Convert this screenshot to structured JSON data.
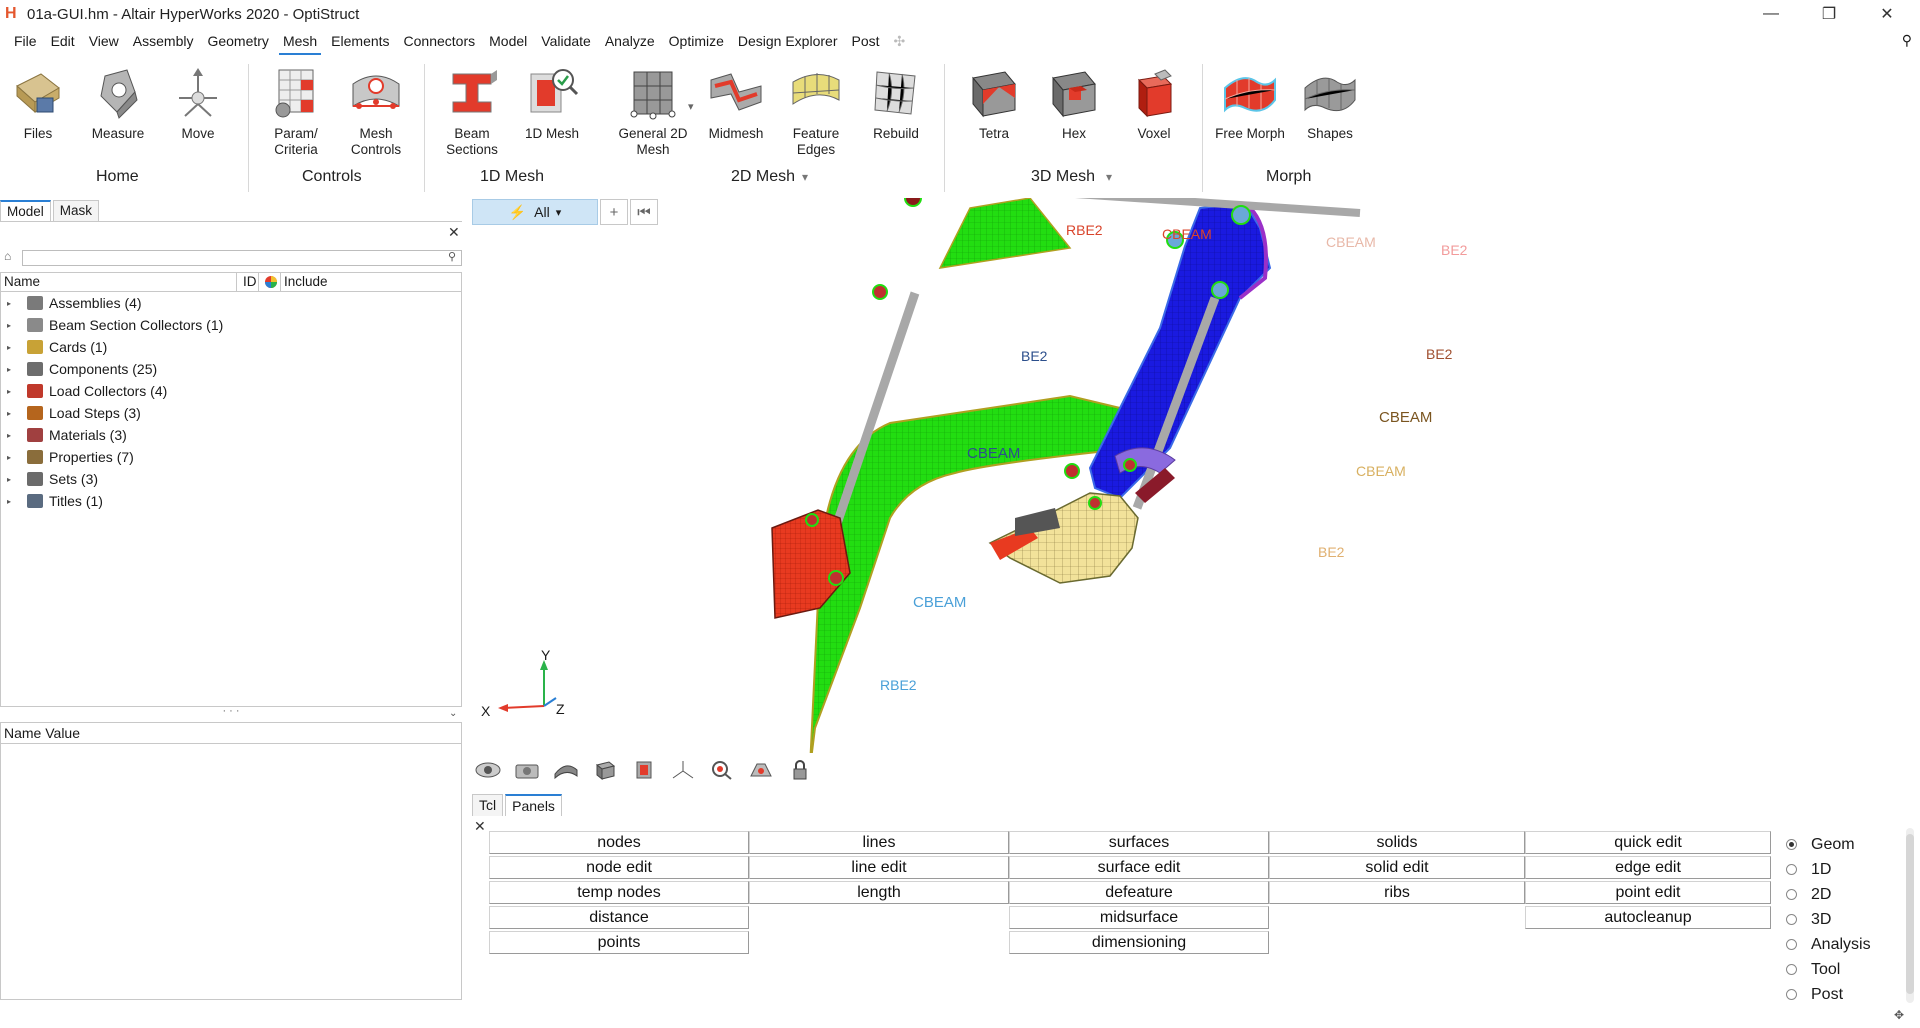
{
  "window": {
    "title": "01a-GUI.hm - Altair HyperWorks 2020 - OptiStruct",
    "logo": "H",
    "minimize": "—",
    "maximize": "❐",
    "close": "✕"
  },
  "menu": {
    "items": [
      "File",
      "Edit",
      "View",
      "Assembly",
      "Geometry",
      "Mesh",
      "Elements",
      "Connectors",
      "Model",
      "Validate",
      "Analyze",
      "Optimize",
      "Design Explorer",
      "Post"
    ],
    "active": "Mesh",
    "add_symbol": "✣",
    "search_symbol": "⚲"
  },
  "ribbon": {
    "tools": [
      {
        "label": "Files",
        "icon": "files-icon"
      },
      {
        "label": "Measure",
        "icon": "measure-icon"
      },
      {
        "label": "Move",
        "icon": "move-icon"
      },
      {
        "label": "Param/\nCriteria",
        "icon": "param-criteria-icon"
      },
      {
        "label": "Mesh\nControls",
        "icon": "mesh-controls-icon"
      },
      {
        "label": "Beam\nSections",
        "icon": "beam-sections-icon"
      },
      {
        "label": "1D Mesh",
        "icon": "1d-mesh-icon"
      },
      {
        "label": "General 2D\nMesh",
        "icon": "general-2d-mesh-icon"
      },
      {
        "label": "Midmesh",
        "icon": "midmesh-icon"
      },
      {
        "label": "Feature\nEdges",
        "icon": "feature-edges-icon"
      },
      {
        "label": "Rebuild",
        "icon": "rebuild-icon"
      },
      {
        "label": "Tetra",
        "icon": "tetra-icon"
      },
      {
        "label": "Hex",
        "icon": "hex-icon"
      },
      {
        "label": "Voxel",
        "icon": "voxel-icon"
      },
      {
        "label": "Free Morph",
        "icon": "free-morph-icon"
      },
      {
        "label": "Shapes",
        "icon": "shapes-icon"
      }
    ],
    "groups": [
      "Home",
      "Controls",
      "1D Mesh",
      "2D Mesh",
      "3D Mesh",
      "Morph"
    ],
    "dropdown_symbol": "▾"
  },
  "left_panel": {
    "tabs": [
      "Model",
      "Mask"
    ],
    "active_tab": "Model",
    "close_symbol": "✕",
    "search_placeholder": "",
    "columns": [
      "Name",
      "ID",
      "Include"
    ],
    "tree": [
      {
        "label": "Assemblies (4)",
        "color": "#7a7a7a"
      },
      {
        "label": "Beam Section Collectors (1)",
        "color": "#8a8a8a"
      },
      {
        "label": "Cards (1)",
        "color": "#c8a236"
      },
      {
        "label": "Components (25)",
        "color": "#6d6d6d"
      },
      {
        "label": "Load Collectors (4)",
        "color": "#c0392b"
      },
      {
        "label": "Load Steps (3)",
        "color": "#b5651d"
      },
      {
        "label": "Materials (3)",
        "color": "#a04040"
      },
      {
        "label": "Properties (7)",
        "color": "#8a6d3b"
      },
      {
        "label": "Sets (3)",
        "color": "#6b6b6b"
      },
      {
        "label": "Titles (1)",
        "color": "#5a6b80"
      }
    ],
    "splitter_symbol": "· · ·",
    "property_header": "Name Value"
  },
  "graphics": {
    "filter_label": "All",
    "filter_add": "+",
    "filter_reset": "⏮",
    "labels": [
      {
        "text": "RBE2",
        "color": "#d9442b"
      },
      {
        "text": "CBEAM",
        "color": "#d9442b"
      },
      {
        "text": "CBEAM",
        "color": "#e8b8a8"
      },
      {
        "text": "BE2",
        "color": "#f29b9b"
      },
      {
        "text": "BE2",
        "color": "#2c4f8c"
      },
      {
        "text": "BE2",
        "color": "#a05030"
      },
      {
        "text": "CBEAM",
        "color": "#2c4f8c"
      },
      {
        "text": "CBEAM",
        "color": "#7a5520"
      },
      {
        "text": "CBEAM",
        "color": "#d8b060"
      },
      {
        "text": "BE2",
        "color": "#e0b070"
      },
      {
        "text": "CBEAM",
        "color": "#4aa0d8"
      },
      {
        "text": "RBE2",
        "color": "#4aa0d8"
      }
    ],
    "axes": {
      "x": "X",
      "y": "Y",
      "z": "Z"
    },
    "colors": {
      "boom": "#22dd11",
      "stick": "#1a1ae0",
      "bucket": "#f2e29a",
      "base": "#e83a20",
      "link": "#8a6adf",
      "rod": "#a8a8a8"
    }
  },
  "view_toolbar": [
    "visibility-icon",
    "camera-icon",
    "cap-icon",
    "cube-view-icon",
    "section-icon",
    "axes-icon",
    "zoom-icon",
    "display-icon",
    "lock-icon"
  ],
  "bottom_panel": {
    "tabs": [
      "Tcl",
      "Panels"
    ],
    "active_tab": "Panels",
    "close_symbol": "✕",
    "buttons": [
      [
        "nodes",
        "lines",
        "surfaces",
        "solids",
        "quick edit"
      ],
      [
        "node edit",
        "line edit",
        "surface edit",
        "solid edit",
        "edge edit"
      ],
      [
        "temp nodes",
        "length",
        "defeature",
        "ribs",
        "point edit"
      ],
      [
        "distance",
        "",
        "midsurface",
        "",
        "autocleanup"
      ],
      [
        "points",
        "",
        "dimensioning",
        "",
        ""
      ]
    ],
    "modes": [
      "Geom",
      "1D",
      "2D",
      "3D",
      "Analysis",
      "Tool",
      "Post"
    ],
    "selected_mode": "Geom"
  }
}
